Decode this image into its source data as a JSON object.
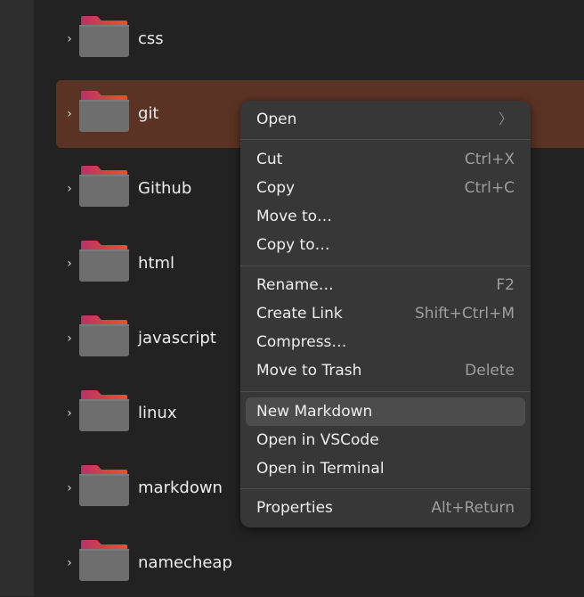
{
  "files": [
    {
      "name": "css"
    },
    {
      "name": "git",
      "selected": true
    },
    {
      "name": "Github"
    },
    {
      "name": "html"
    },
    {
      "name": "javascript"
    },
    {
      "name": "linux"
    },
    {
      "name": "markdown"
    },
    {
      "name": "namecheap"
    }
  ],
  "context_menu": {
    "open": {
      "label": "Open",
      "icon": "chevron-right-icon"
    },
    "cut": {
      "label": "Cut",
      "accel": "Ctrl+X"
    },
    "copy": {
      "label": "Copy",
      "accel": "Ctrl+C"
    },
    "move_to": {
      "label": "Move to…"
    },
    "copy_to": {
      "label": "Copy to…"
    },
    "rename": {
      "label": "Rename…",
      "accel": "F2"
    },
    "create_link": {
      "label": "Create Link",
      "accel": "Shift+Ctrl+M"
    },
    "compress": {
      "label": "Compress…"
    },
    "move_to_trash": {
      "label": "Move to Trash",
      "accel": "Delete"
    },
    "new_markdown": {
      "label": "New Markdown",
      "highlighted": true
    },
    "open_in_vscode": {
      "label": "Open in VSCode"
    },
    "open_in_terminal": {
      "label": "Open in Terminal"
    },
    "properties": {
      "label": "Properties",
      "accel": "Alt+Return"
    }
  },
  "colors": {
    "selection": "#5b3324",
    "folder_tab_gradient": [
      "#b8336a",
      "#e95420"
    ],
    "folder_body": "#6e6e6e"
  }
}
